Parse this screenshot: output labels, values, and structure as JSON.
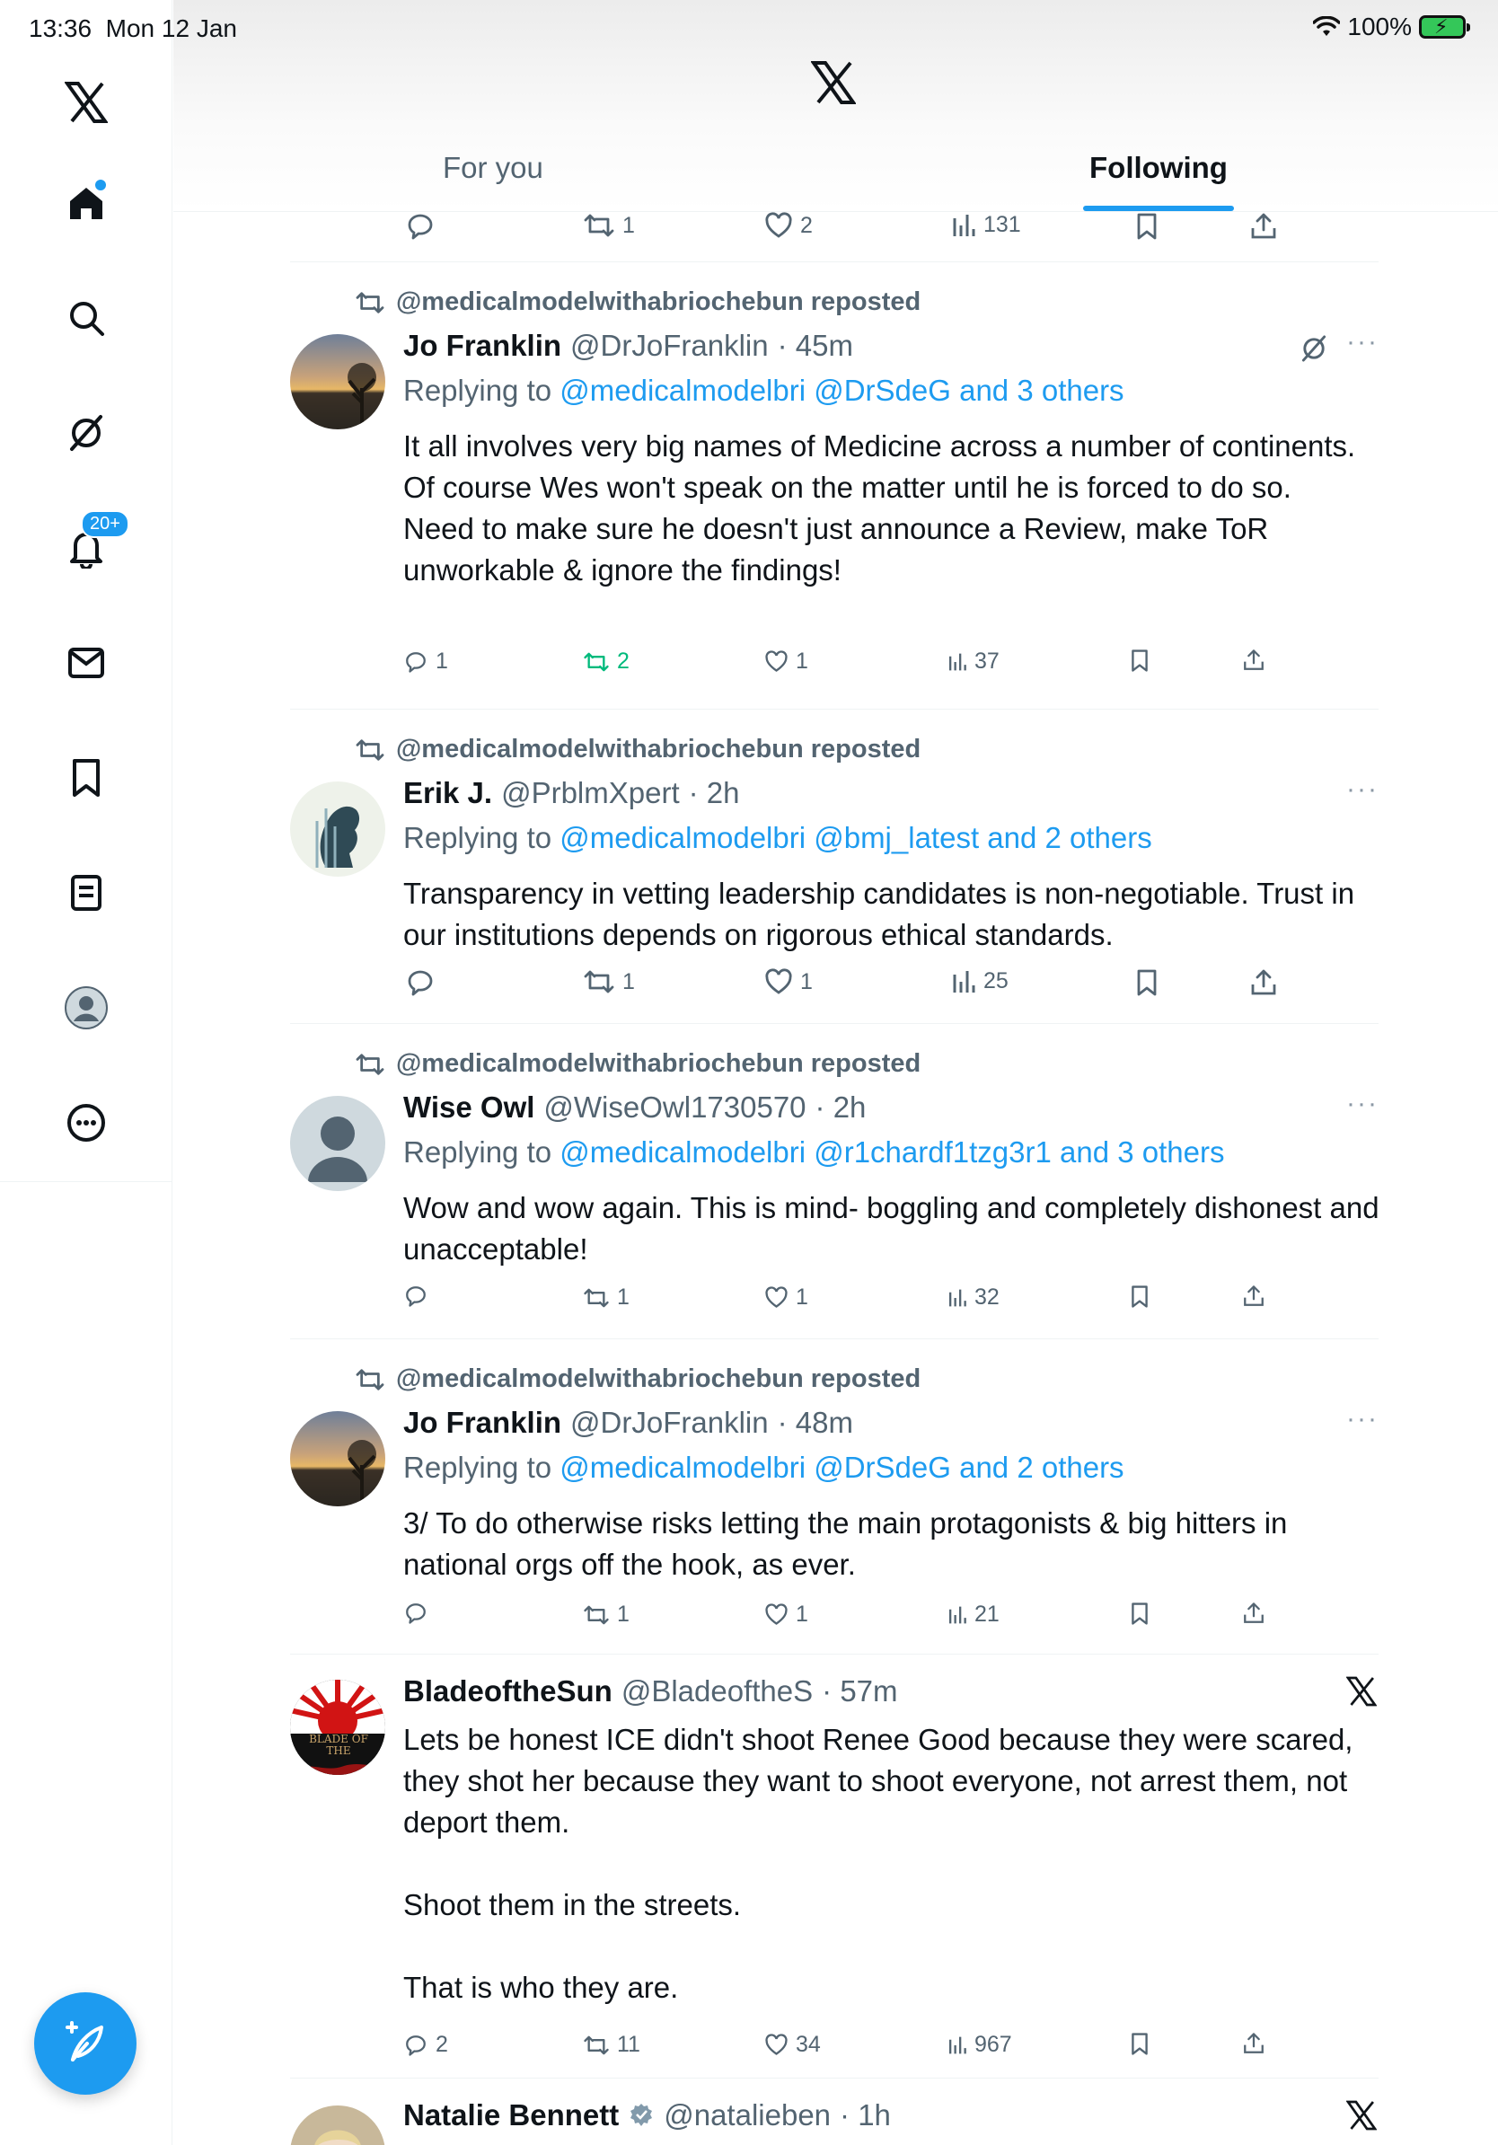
{
  "status_bar": {
    "time": "13:36",
    "date": "Mon 12 Jan",
    "battery": "100%"
  },
  "sidebar": {
    "items": [
      {
        "name": "x-logo-icon"
      },
      {
        "name": "home-icon"
      },
      {
        "name": "search-icon"
      },
      {
        "name": "grok-icon"
      },
      {
        "name": "notifications-icon",
        "badge": "20+"
      },
      {
        "name": "messages-icon"
      },
      {
        "name": "bookmarks-icon"
      },
      {
        "name": "lists-icon"
      },
      {
        "name": "profile-icon"
      },
      {
        "name": "more-icon"
      }
    ],
    "compose_icon": "compose-icon"
  },
  "header": {
    "tabs": [
      {
        "label": "For you",
        "active": false
      },
      {
        "label": "Following",
        "active": true
      }
    ]
  },
  "colors": {
    "accent": "#1d9bf0",
    "repost_active": "#00ba7c",
    "muted": "#536471"
  },
  "feed": {
    "top_partial": {
      "replies": "",
      "reposts": "1",
      "likes": "2",
      "views": "131"
    },
    "posts": [
      {
        "repost_by": "@medicalmodelwithabriochebun reposted",
        "name": "Jo Franklin",
        "handle": "@DrJoFranklin",
        "time": "· 45m",
        "reply_prefix": "Replying to",
        "reply_to": "@medicalmodelbri @DrSdeG and 3 others",
        "text": "It all involves very big names of Medicine across a number of continents. Of course Wes won't speak on the matter until he is forced to do so.\nNeed to make sure he doesn't just announce a Review, make ToR unworkable & ignore the findings!",
        "replies": "1",
        "reposts": "2",
        "likes": "1",
        "views": "37"
      },
      {
        "repost_by": "@medicalmodelwithabriochebun reposted",
        "name": "Erik J.",
        "handle": "@PrblmXpert",
        "time": "· 2h",
        "reply_prefix": "Replying to",
        "reply_to": "@medicalmodelbri @bmj_latest and 2 others",
        "text": "Transparency in vetting leadership candidates is non-negotiable. Trust in our institutions depends on rigorous ethical standards.",
        "replies": "",
        "reposts": "1",
        "likes": "1",
        "views": "25"
      },
      {
        "repost_by": "@medicalmodelwithabriochebun reposted",
        "name": "Wise Owl",
        "handle": "@WiseOwl1730570",
        "time": "· 2h",
        "reply_prefix": "Replying to",
        "reply_to": "@medicalmodelbri @r1chardf1tzg3r1 and 3 others",
        "text": "Wow and wow again. This is mind- boggling and completely dishonest and unacceptable!",
        "replies": "",
        "reposts": "1",
        "likes": "1",
        "views": "32"
      },
      {
        "repost_by": "@medicalmodelwithabriochebun reposted",
        "name": "Jo Franklin",
        "handle": "@DrJoFranklin",
        "time": "· 48m",
        "reply_prefix": "Replying to",
        "reply_to": "@medicalmodelbri @DrSdeG and 2 others",
        "text": "3/ To do otherwise risks letting the main protagonists & big hitters in national orgs off the hook, as ever.",
        "replies": "",
        "reposts": "1",
        "likes": "1",
        "views": "21"
      },
      {
        "name": "BladeoftheSun",
        "handle": "@BladeoftheS",
        "time": "· 57m",
        "avatar_text": "BLADE OF THE",
        "text": "Lets be honest ICE didn't shoot Renee Good because they were scared, they shot her because they want to shoot everyone, not arrest them, not deport them.\n\nShoot them in the streets.\n\nThat is who they are.",
        "replies": "2",
        "reposts": "11",
        "likes": "34",
        "views": "967"
      },
      {
        "name": "Natalie Bennett",
        "handle": "@natalieben",
        "time": "· 1h"
      }
    ]
  }
}
